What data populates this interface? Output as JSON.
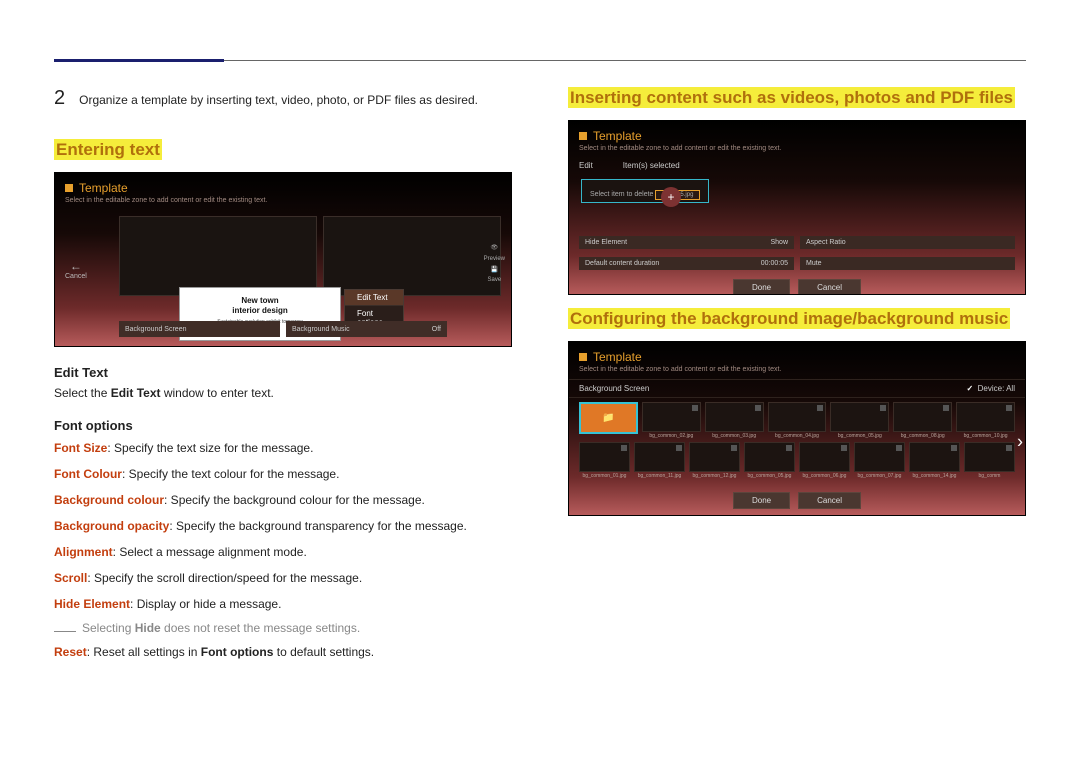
{
  "step": {
    "num": "2",
    "text": "Organize a template by inserting text, video, photo, or PDF files as desired."
  },
  "left": {
    "heading": "Entering text",
    "editText": {
      "heading": "Edit Text",
      "body_pre": "Select the ",
      "body_bold": "Edit Text",
      "body_post": " window to enter text."
    },
    "fontOptions": {
      "heading": "Font options",
      "items": [
        {
          "k": "Font Size",
          "t": ": Specify the text size for the message."
        },
        {
          "k": "Font Colour",
          "t": ": Specify the text colour for the message."
        },
        {
          "k": "Background colour",
          "t": ": Specify the background colour for the message."
        },
        {
          "k": "Background opacity",
          "t": ": Specify the background transparency for the message."
        },
        {
          "k": "Alignment",
          "t": ": Select a message alignment mode."
        },
        {
          "k": "Scroll",
          "t": ": Specify the scroll direction/speed for the message."
        },
        {
          "k": "Hide Element",
          "t": ": Display or hide a message."
        }
      ],
      "note_pre": "Selecting ",
      "note_bold": "Hide",
      "note_post": " does not reset the message settings.",
      "reset_k": "Reset",
      "reset_mid": ": Reset all settings in ",
      "reset_bold2": "Font options",
      "reset_post": " to default settings."
    }
  },
  "right": {
    "heading1": "Inserting content such as videos, photos and PDF files",
    "heading2": "Configuring the background image/background music"
  },
  "mock1": {
    "title": "Template",
    "sub": "Select in the editable zone to add content or edit the existing text.",
    "cancel": "Cancel",
    "side_preview": "Preview",
    "side_save": "Save",
    "text_line1": "New town",
    "text_line2": "interior design",
    "text_sub": "Sustainable evolution exhibit tomorrow design",
    "menu1": "Edit Text",
    "menu2": "Font options",
    "bg_screen": "Background Screen",
    "bg_music": "Background Music",
    "bg_music_val": "Off"
  },
  "mock2": {
    "title": "Template",
    "sub": "Select in the editable zone to add content or edit the existing text.",
    "edit": "Edit",
    "sel": "Item(s) selected",
    "delete_hint": "Select item to delete",
    "thumb": "picture5.jpg",
    "r1a": "Hide Element",
    "r1av": "Show",
    "r1b": "Aspect Ratio",
    "r2a": "Default content duration",
    "r2av": "00:00:05",
    "r2b": "Mute",
    "done": "Done",
    "cancel": "Cancel"
  },
  "mock3": {
    "title": "Template",
    "sub": "Select in the editable zone to add content or edit the existing text.",
    "bg_screen": "Background Screen",
    "device": "Device: All",
    "row1": [
      "",
      "bg_common_02.jpg",
      "bg_common_03.jpg",
      "bg_common_04.jpg",
      "bg_common_05.jpg",
      "bg_common_08.jpg",
      "bg_common_10.jpg"
    ],
    "row2": [
      "bg_common_01.jpg",
      "bg_common_11.jpg",
      "bg_common_12.jpg",
      "bg_common_05.jpg",
      "bg_common_06.jpg",
      "bg_common_07.jpg",
      "bg_common_14.jpg",
      "bg_comm"
    ],
    "done": "Done",
    "cancel": "Cancel"
  }
}
